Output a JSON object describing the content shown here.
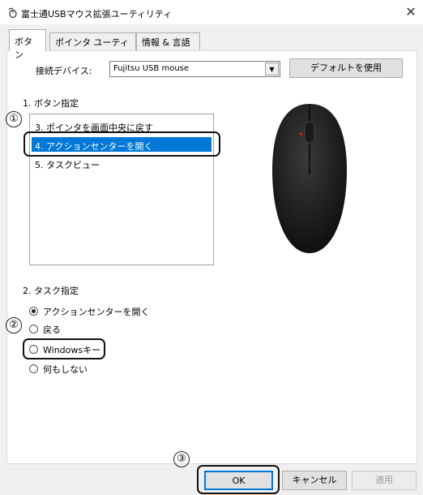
{
  "window": {
    "title": "富士通USBマウス拡張ユーティリティ",
    "close_icon": "close-icon"
  },
  "tabs": [
    {
      "label": "ボタン",
      "active": true
    },
    {
      "label": "ポインタ ユーティリティ",
      "active": false
    },
    {
      "label": "情報 & 言語",
      "active": false
    }
  ],
  "device": {
    "label": "接続デバイス:",
    "selected": "Fujitsu USB mouse",
    "default_button": "デフォルトを使用"
  },
  "button_section": {
    "heading": "1. ボタン指定",
    "items": [
      "3. ポインタを画面中央に戻す",
      "4. アクションセンターを開く",
      "5. タスクビュー"
    ],
    "selected_index": 1
  },
  "task_section": {
    "heading": "2. タスク指定",
    "options": [
      "アクションセンターを開く",
      "戻る",
      "Windowsキー",
      "何もしない"
    ],
    "selected_index": 0
  },
  "callouts": [
    "①",
    "②",
    "③"
  ],
  "footer": {
    "ok": "OK",
    "cancel": "キャンセル",
    "apply": "適用"
  },
  "colors": {
    "selection": "#0078d7",
    "dialog_bg": "#f0f0f0"
  }
}
